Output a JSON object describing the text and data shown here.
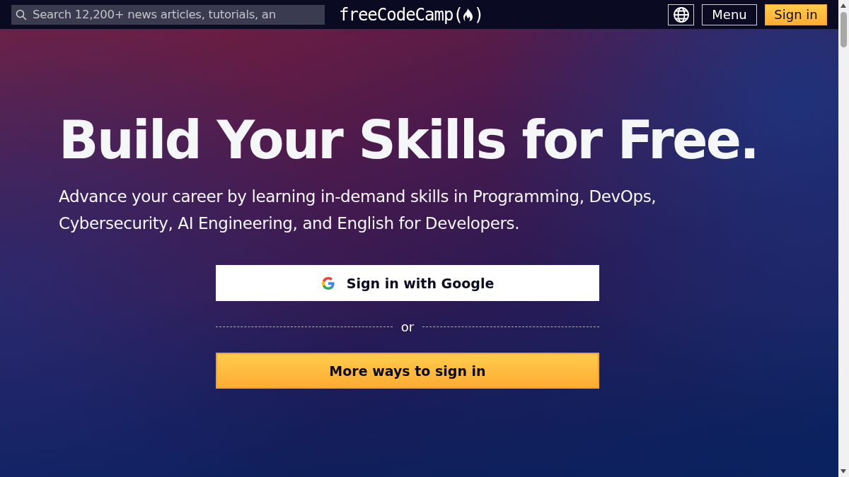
{
  "nav": {
    "search": {
      "placeholder": "Search 12,200+ news articles, tutorials, an"
    },
    "logo": {
      "text_before": "freeCodeCamp(",
      "text_after": ")"
    },
    "buttons": [
      {
        "kind": "language"
      },
      {
        "kind": "menu",
        "label": "Menu"
      },
      {
        "kind": "signin",
        "label": "Sign in"
      }
    ]
  },
  "hero": {
    "title": "Build Your Skills for Free.",
    "subtitle": "Advance your career by learning in-demand skills in Programming, DevOps, Cybersecurity, AI Engineering, and English for Developers.",
    "google_button": "Sign in with Google",
    "divider": "or",
    "more_button": "More ways to sign in"
  }
}
